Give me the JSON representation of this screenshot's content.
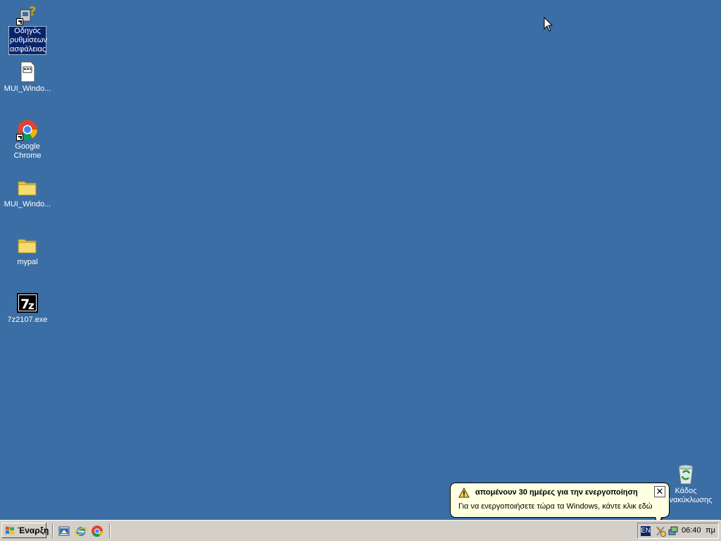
{
  "desktop": {
    "background": "#3A6EA5",
    "icons": [
      {
        "label": "Οδηγός ρυθμίσεων ασφάλειας",
        "icon": "security-wizard-icon",
        "shortcut": true,
        "selected": true
      },
      {
        "label": "MUI_Windo...",
        "icon": "file-icon",
        "shortcut": false
      },
      {
        "label": "Google Chrome",
        "icon": "chrome-icon",
        "shortcut": true
      },
      {
        "label": "MUI_Windo...",
        "icon": "folder-icon",
        "shortcut": false
      },
      {
        "label": "mypal",
        "icon": "folder-icon",
        "shortcut": false
      },
      {
        "label": "7z2107.exe",
        "icon": "7zip-icon",
        "shortcut": false
      }
    ],
    "recycle_bin": {
      "label": "Κάδος ανακύκλωσης",
      "icon": "recycle-bin-icon"
    }
  },
  "taskbar": {
    "start_label": "Έναρξη",
    "quicklaunch": [
      "show-desktop-icon",
      "internet-explorer-icon",
      "chrome-icon"
    ],
    "tray": {
      "language": "EN",
      "icons": [
        "security-alert-icon",
        "network-icon"
      ],
      "clock": "06:40",
      "ampm": "πμ"
    }
  },
  "balloon": {
    "title": "απομένουν 30 ημέρες για την ενεργοποίηση",
    "text": "Για να ενεργοποιήσετε τώρα τα Windows, κάντε κλικ εδώ",
    "close": "✕"
  }
}
